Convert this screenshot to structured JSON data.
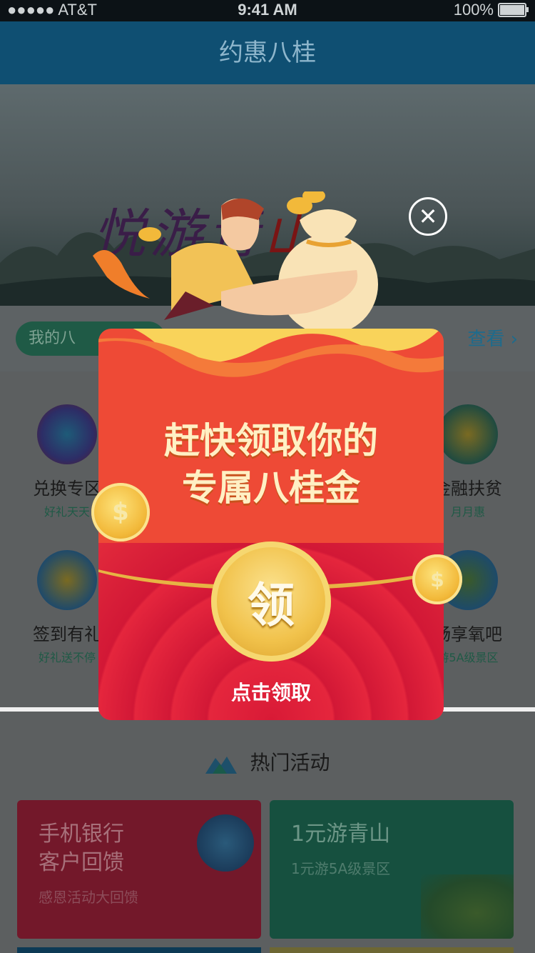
{
  "status_bar": {
    "carrier": "●●●●● AT&T",
    "time": "9:41 AM",
    "battery": "100%"
  },
  "nav": {
    "title": "约惠八桂"
  },
  "banner": {
    "title_main": "悦游青",
    "title_accent": "山"
  },
  "subrow": {
    "pill_label": "我的八",
    "view_more": "查看"
  },
  "grid": {
    "items": [
      {
        "title": "兑换专区",
        "subtitle": "好礼天天"
      },
      {
        "title": "金融扶贫",
        "subtitle": "月月惠"
      },
      {
        "title": "签到有礼",
        "subtitle": "好礼送不停"
      },
      {
        "title": "畅享氧吧",
        "subtitle": "游5A级景区"
      }
    ]
  },
  "hot": {
    "section_title": "热门活动",
    "cards": [
      {
        "title_line1": "手机银行",
        "title_line2": "客户回馈",
        "subtitle": "感恩活动大回馈"
      },
      {
        "title_line1": "1元游青山",
        "title_line2": "",
        "subtitle": "1元游5A级景区"
      }
    ]
  },
  "popup": {
    "headline_line1": "赶快领取你的",
    "headline_line2": "专属八桂金",
    "claim_button": "领",
    "claim_text": "点击领取",
    "close_symbol": "✕",
    "coin_symbol": "$"
  },
  "colors": {
    "popup_red": "#ee4a36",
    "gold": "#f1c24b",
    "nav_blue": "#0f4f72"
  }
}
